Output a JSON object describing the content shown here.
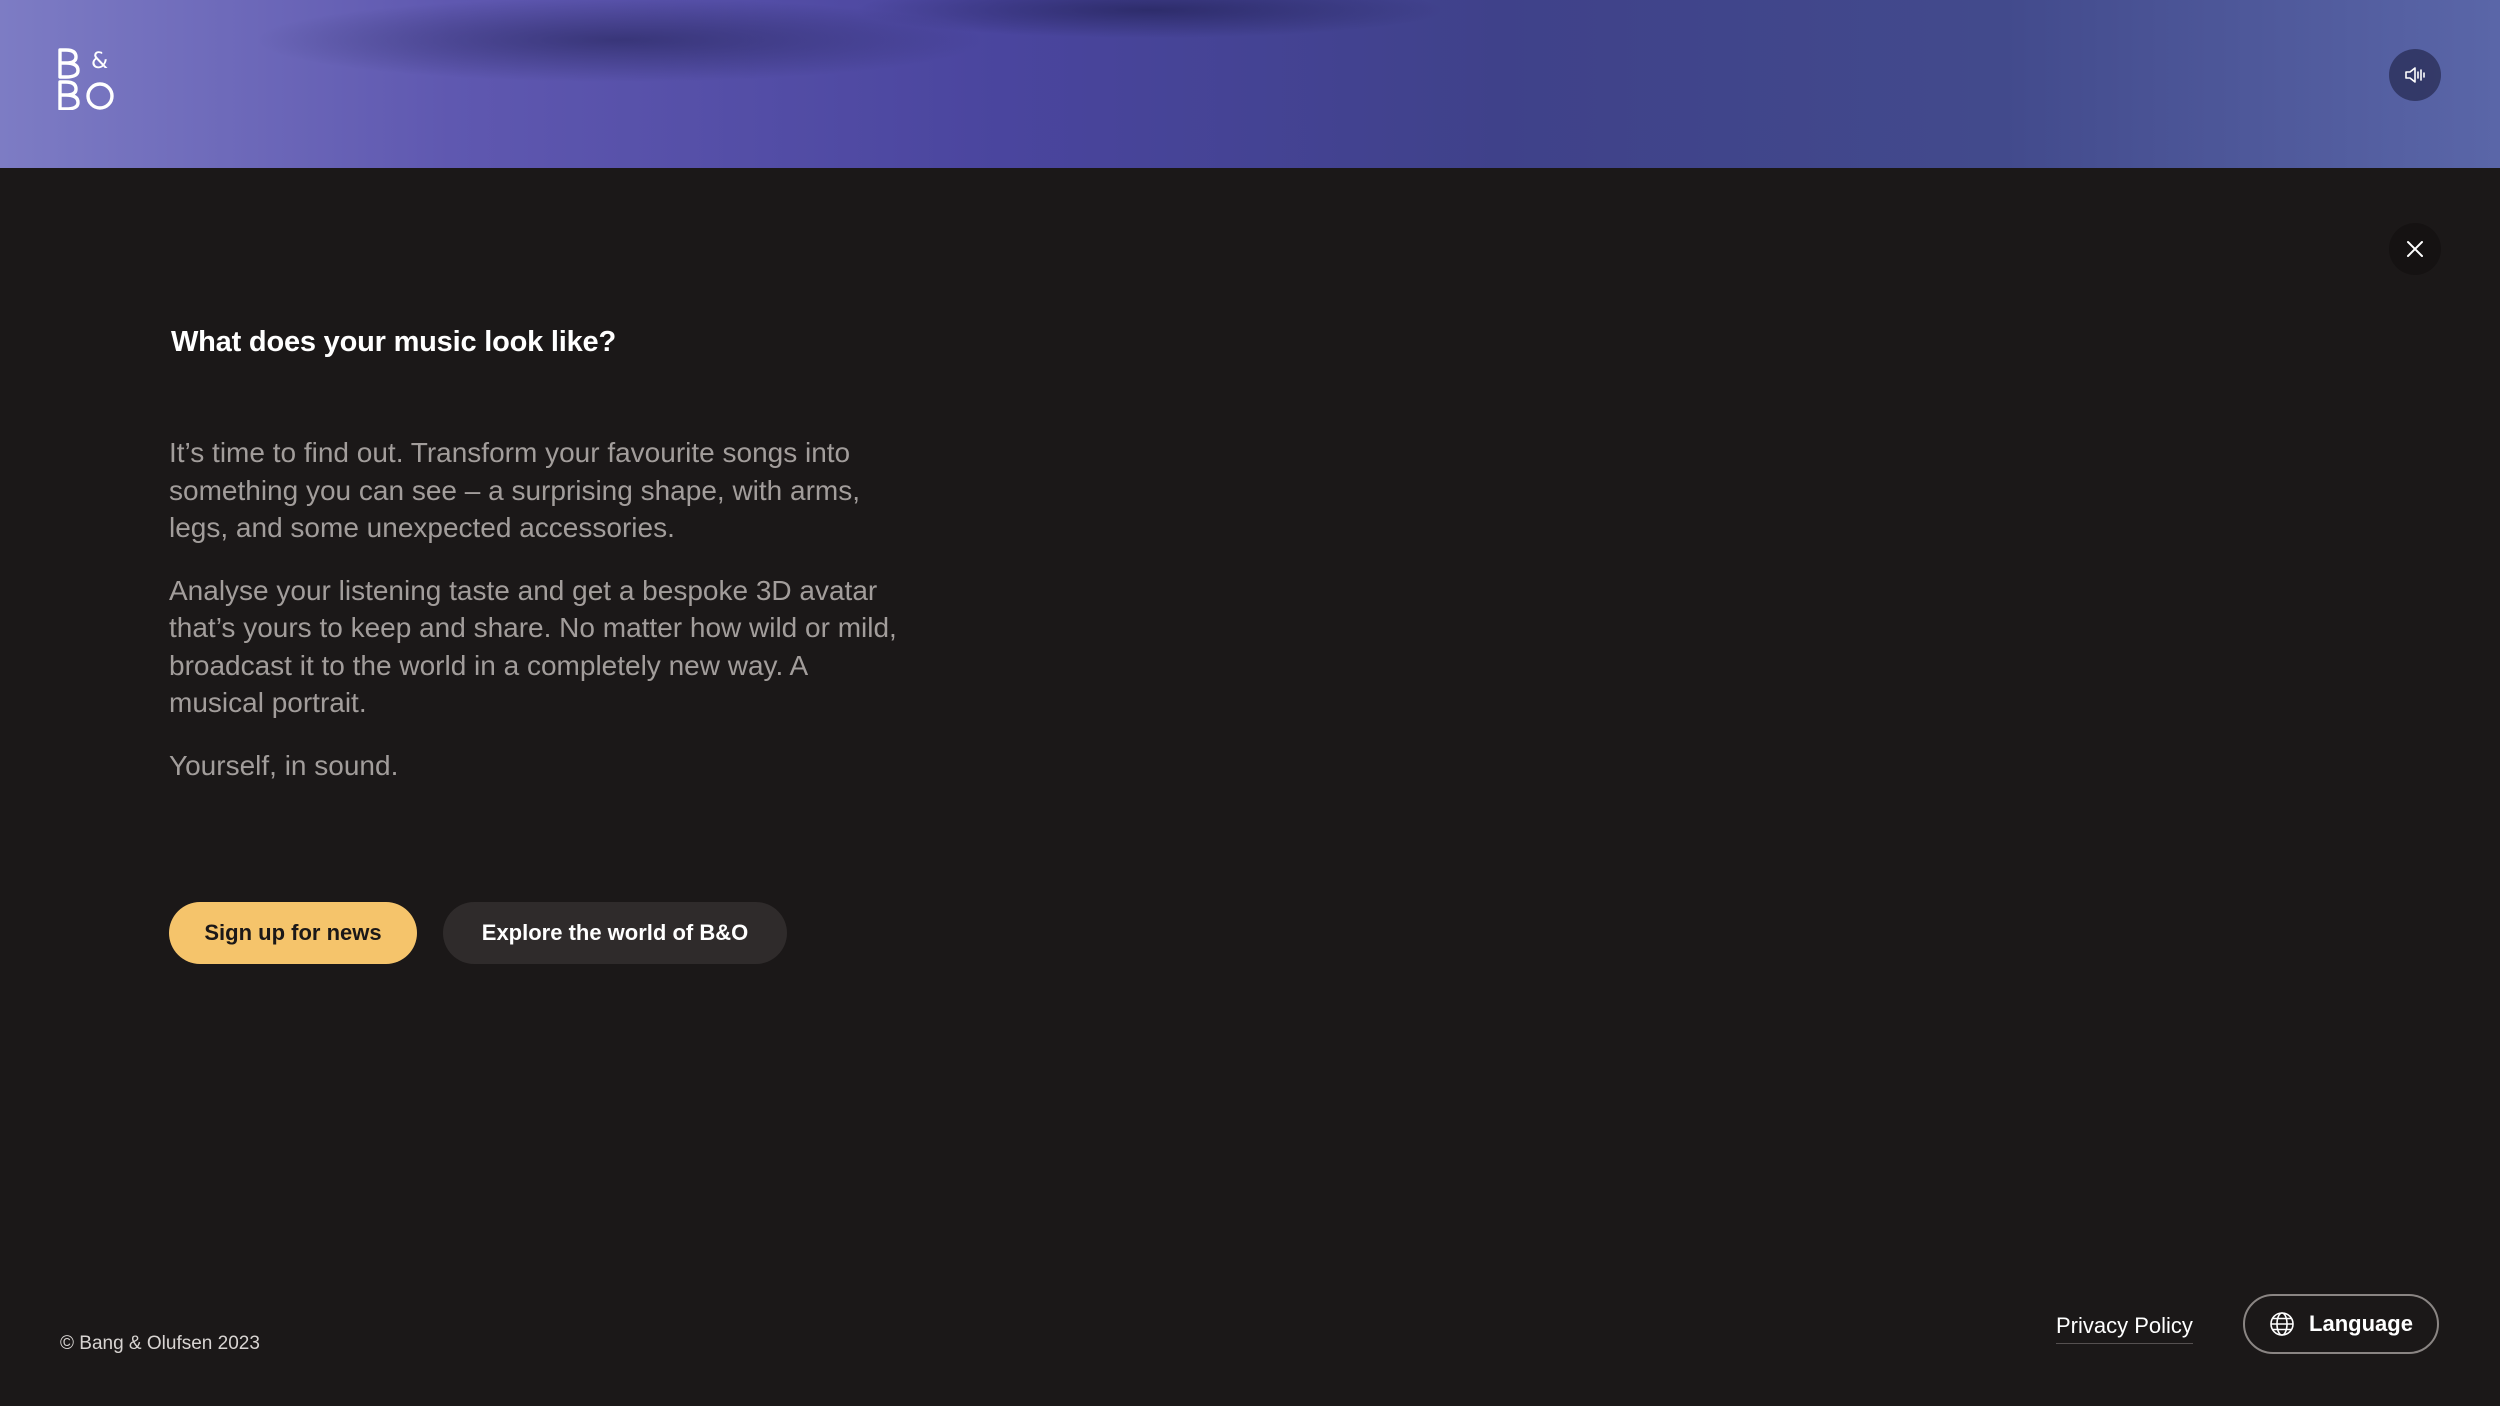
{
  "header": {
    "logo_icon": "bang-olufsen-logo",
    "sound_icon": "speaker-icon"
  },
  "modal": {
    "close_icon": "close-icon",
    "title": "What does your music look like?",
    "paragraphs": [
      "It’s time to find out. Transform your favourite songs into something you can see – a surprising shape, with arms, legs, and some unexpected accessories.",
      "Analyse your listening taste and get a bespoke 3D avatar that’s yours to keep and share. No matter how wild or mild, broadcast it to the world in a completely new way. A musical portrait.",
      "Yourself, in sound."
    ],
    "primary_button": "Sign up for news",
    "secondary_button": "Explore the world of B&O"
  },
  "footer": {
    "copyright": "© Bang & Olufsen 2023",
    "privacy_link": "Privacy Policy",
    "language_button": "Language",
    "language_icon": "globe-icon"
  },
  "colors": {
    "background": "#1b1818",
    "accent": "#f5c46b",
    "secondary_button": "#2f2b2b",
    "body_text": "#a29d9b"
  }
}
